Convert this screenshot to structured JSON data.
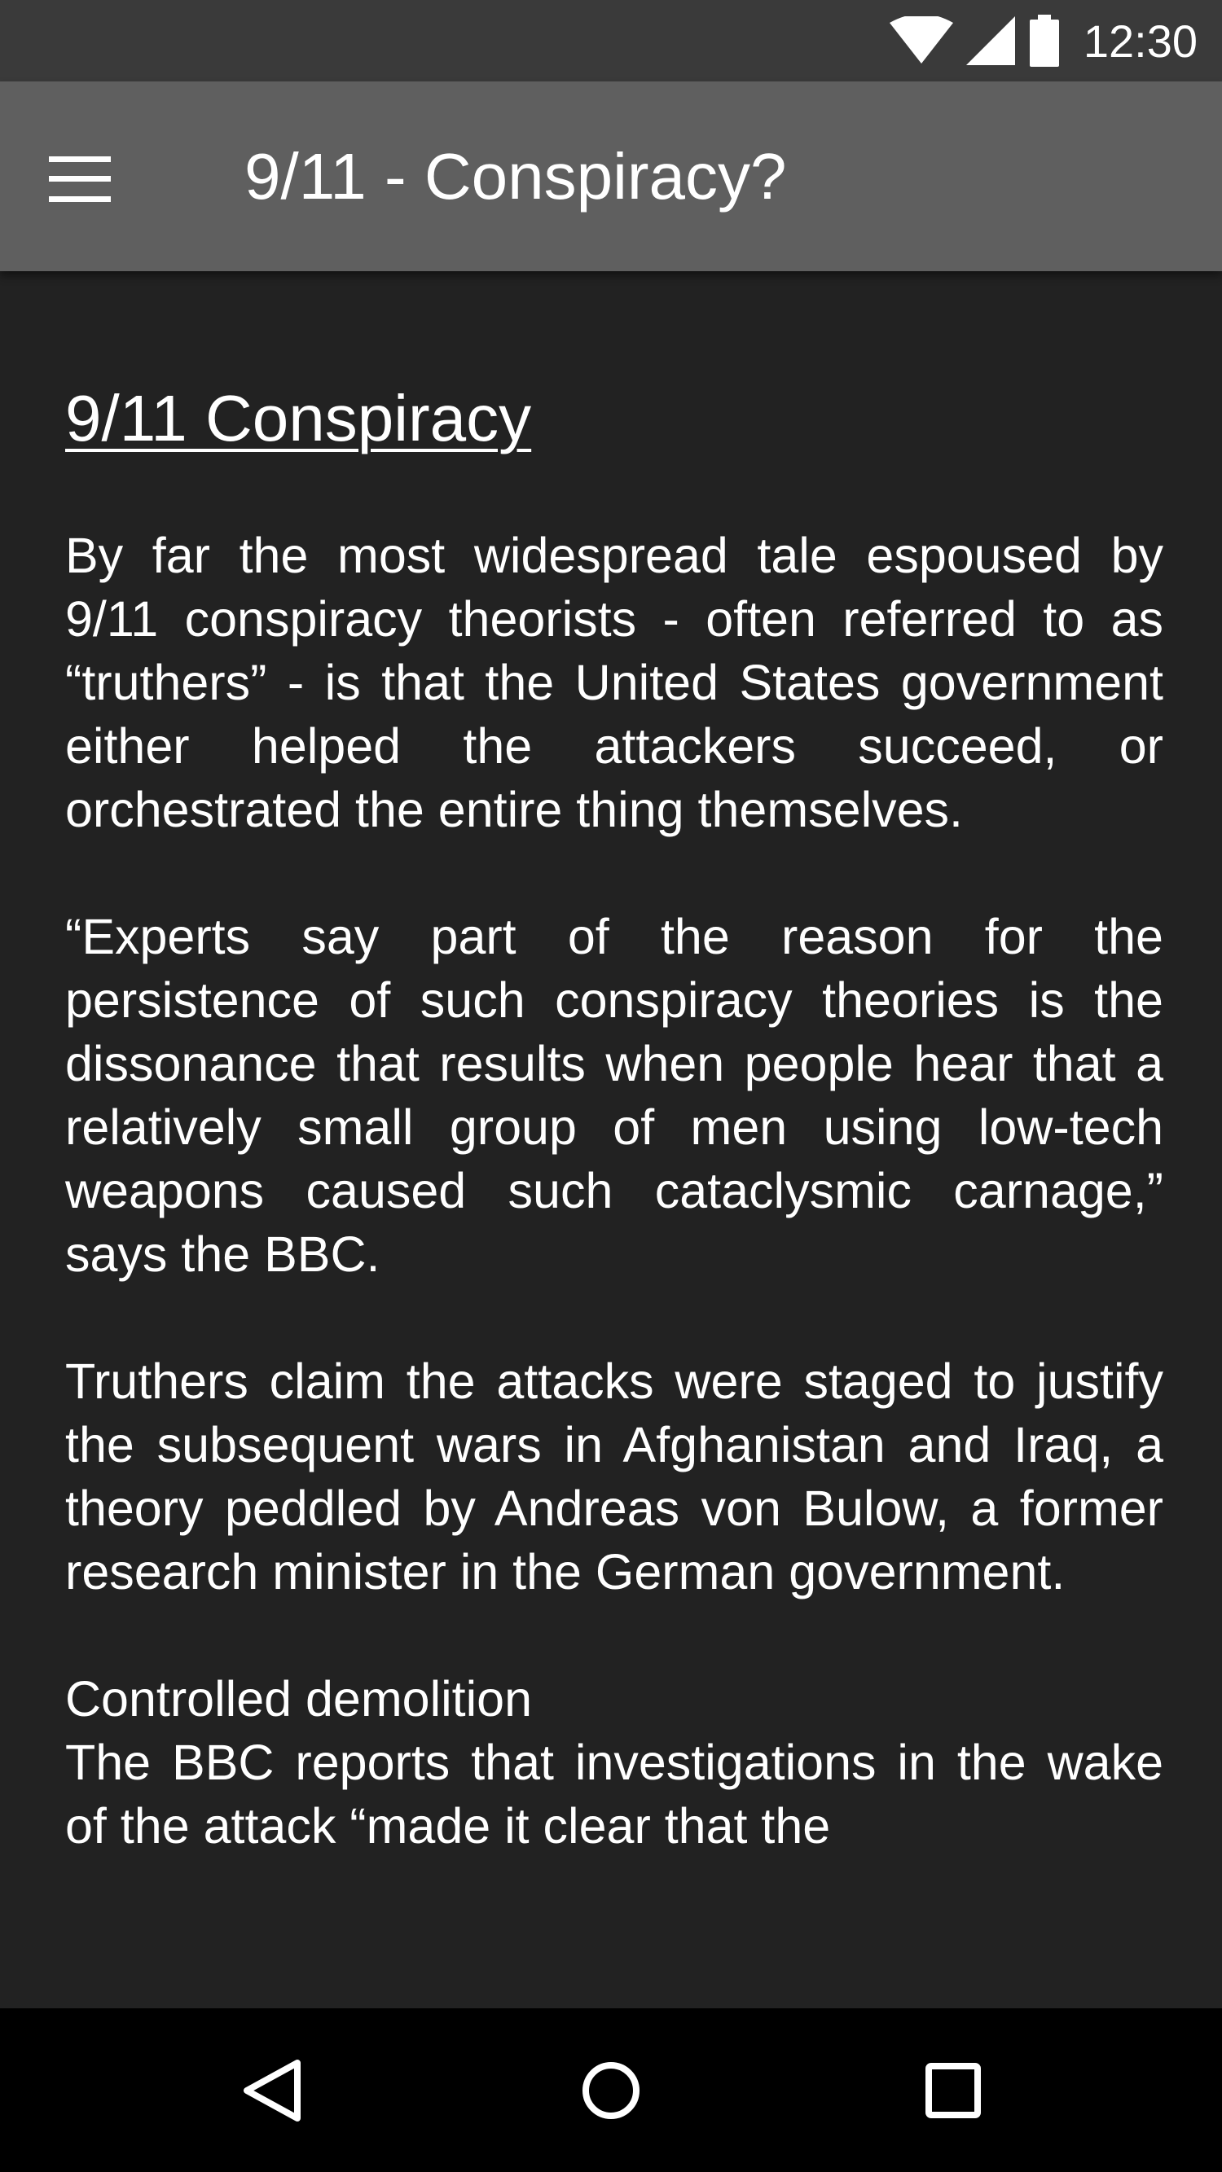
{
  "status_bar": {
    "time": "12:30",
    "icons": [
      "wifi-icon",
      "cell-signal-icon",
      "battery-icon"
    ]
  },
  "app_bar": {
    "title": "9/11 - Conspiracy?",
    "menu_icon": "hamburger-menu-icon"
  },
  "article": {
    "heading": "9/11 Conspiracy",
    "paragraphs": [
      "By far the most widespread tale espoused by 9/11 conspiracy theorists - often referred to as “truthers” - is that the United States government either helped the attackers succeed, or orchestrated the entire thing themselves.",
      "“Experts say part of the reason for the persistence of such conspiracy theories is the dissonance that results when people hear that a relatively small group of men using low-tech weapons caused such cataclysmic carnage,” says the BBC.",
      "Truthers claim the attacks were staged to justify the subsequent wars in Afghanistan and Iraq, a theory peddled by Andreas von Bulow, a former research minister in the German government."
    ],
    "subheading": "Controlled demolition",
    "partial_paragraph": "The BBC reports that investigations in the wake of the attack “made it clear that the"
  },
  "nav_bar": {
    "back_icon": "back-triangle-icon",
    "home_icon": "home-circle-icon",
    "recents_icon": "recents-square-icon"
  },
  "colors": {
    "status_bar": "#3a3a3a",
    "app_bar": "#5f5f5f",
    "content_bg": "#222222",
    "text": "#ffffff",
    "nav_bar": "#000000"
  }
}
